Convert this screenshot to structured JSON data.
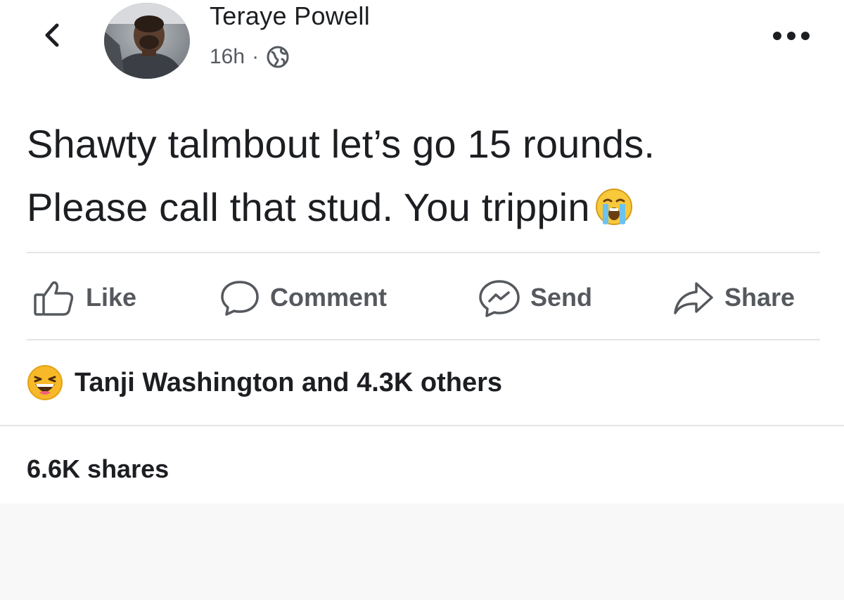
{
  "post": {
    "author": "Teraye Powell",
    "time": "16h",
    "separator": "·",
    "audience_icon": "globe-icon",
    "text_line1": "Shawty talmbout let’s go 15 rounds.",
    "text_line2": "Please call that stud. You trippin",
    "text_emoji": "loudly-crying-face-emoji"
  },
  "header": {
    "back_icon": "chevron-left-icon",
    "more_icon": "more-horizontal-icon"
  },
  "actions": [
    {
      "label": "Like",
      "icon": "thumbs-up-icon"
    },
    {
      "label": "Comment",
      "icon": "comment-bubble-icon"
    },
    {
      "label": "Send",
      "icon": "messenger-icon"
    },
    {
      "label": "Share",
      "icon": "share-arrow-icon"
    }
  ],
  "reactions": {
    "emoji": "haha-reaction-icon",
    "summary": "Tanji Washington and 4.3K others"
  },
  "shares": {
    "label": "6.6K shares"
  },
  "colors": {
    "text": "#1c1e21",
    "muted": "#555a60",
    "divider": "#e3e5e8",
    "reaction_yellow": "#f7b928"
  }
}
